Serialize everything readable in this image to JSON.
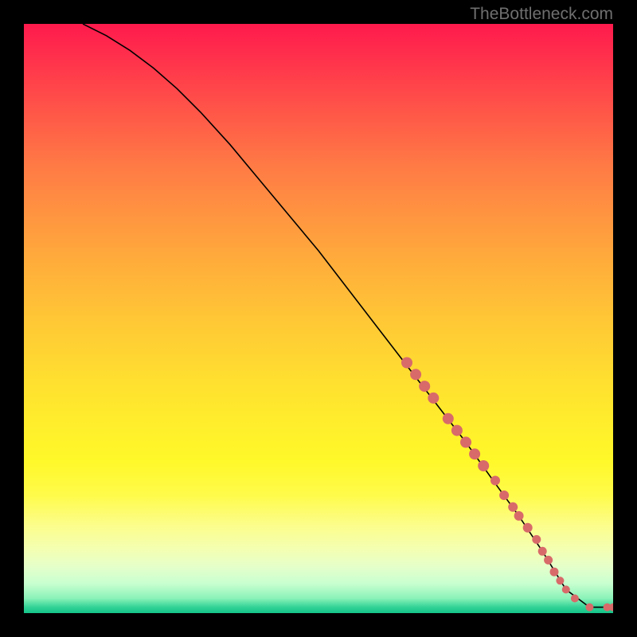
{
  "attribution": "TheBottleneck.com",
  "colors": {
    "frame": "#000000",
    "curve": "#000000",
    "dot": "#d86a6a",
    "gradient_top": "#ff1a4d",
    "gradient_mid": "#ffde30",
    "gradient_bottom": "#15c48a"
  },
  "chart_data": {
    "type": "line",
    "title": "",
    "xlabel": "",
    "ylabel": "",
    "xlim": [
      0,
      100
    ],
    "ylim": [
      0,
      100
    ],
    "grid": false,
    "legend": false,
    "series": [
      {
        "name": "curve",
        "x": [
          10,
          14,
          18,
          22,
          26,
          30,
          35,
          40,
          45,
          50,
          55,
          60,
          65,
          70,
          75,
          80,
          84,
          88,
          92,
          96,
          100
        ],
        "y": [
          100,
          98,
          95.5,
          92.5,
          89,
          85,
          79.5,
          73.5,
          67.5,
          61.5,
          55,
          48.5,
          42,
          35.5,
          29,
          22,
          16.5,
          10.5,
          4,
          1,
          1
        ]
      }
    ],
    "scatter": {
      "name": "cluster",
      "points": [
        {
          "x": 65,
          "y": 42.5,
          "r": 7
        },
        {
          "x": 66.5,
          "y": 40.5,
          "r": 7
        },
        {
          "x": 68,
          "y": 38.5,
          "r": 7
        },
        {
          "x": 69.5,
          "y": 36.5,
          "r": 7
        },
        {
          "x": 72,
          "y": 33,
          "r": 7
        },
        {
          "x": 73.5,
          "y": 31,
          "r": 7
        },
        {
          "x": 75,
          "y": 29,
          "r": 7
        },
        {
          "x": 76.5,
          "y": 27,
          "r": 7
        },
        {
          "x": 78,
          "y": 25,
          "r": 7
        },
        {
          "x": 80,
          "y": 22.5,
          "r": 6
        },
        {
          "x": 81.5,
          "y": 20,
          "r": 6
        },
        {
          "x": 83,
          "y": 18,
          "r": 6
        },
        {
          "x": 84,
          "y": 16.5,
          "r": 6
        },
        {
          "x": 85.5,
          "y": 14.5,
          "r": 6
        },
        {
          "x": 87,
          "y": 12.5,
          "r": 5.5
        },
        {
          "x": 88,
          "y": 10.5,
          "r": 5.5
        },
        {
          "x": 89,
          "y": 9,
          "r": 5.5
        },
        {
          "x": 90,
          "y": 7,
          "r": 5.5
        },
        {
          "x": 91,
          "y": 5.5,
          "r": 5
        },
        {
          "x": 92,
          "y": 4,
          "r": 5
        },
        {
          "x": 93.5,
          "y": 2.5,
          "r": 5
        },
        {
          "x": 96,
          "y": 1,
          "r": 5
        },
        {
          "x": 99,
          "y": 1,
          "r": 5
        },
        {
          "x": 100,
          "y": 1,
          "r": 5
        }
      ]
    }
  }
}
